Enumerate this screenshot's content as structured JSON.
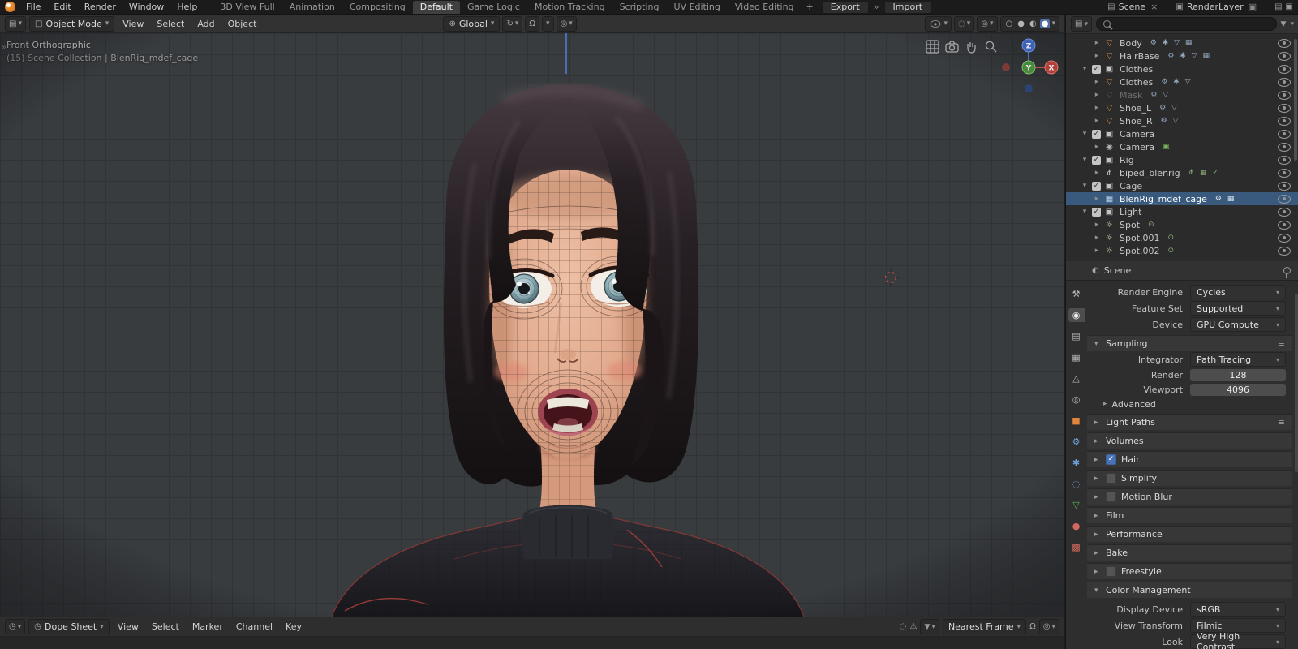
{
  "icons": {
    "disclosure_collapsed": "▸",
    "disclosure_expanded": "▾",
    "dropdown_arrow": "▾",
    "mesh": "▽",
    "collection": "▣",
    "camera": "◉",
    "armature": "⋔",
    "lattice": "▦",
    "light": "☼",
    "check": "✓",
    "menu": "≡",
    "orientation_globe": "⊕",
    "pivot": "↻",
    "magnet": "Ω",
    "proportional": "◎",
    "close": "×",
    "chevrons": "»",
    "mode_cube": "□",
    "editor_grid": "▤",
    "scene_strip": "▤",
    "layers": "▣",
    "warning": "⚠",
    "funnel": "▼",
    "ghost": "◌",
    "clock": "◷",
    "ball": "●",
    "ball_open": "○",
    "ball_half": "◐"
  },
  "topbar": {
    "app_menus": [
      "File",
      "Edit",
      "Render",
      "Window",
      "Help"
    ],
    "workspaces": [
      "3D View Full",
      "Animation",
      "Compositing",
      "Default",
      "Game Logic",
      "Motion Tracking",
      "Scripting",
      "UV Editing",
      "Video Editing"
    ],
    "active_workspace": "Default",
    "new_workspace_button": "+",
    "export_button": "Export",
    "import_button": "Import",
    "scene_name": "Scene",
    "render_layer_name": "RenderLayer"
  },
  "viewport_header": {
    "mode": "Object Mode",
    "menus": [
      "View",
      "Select",
      "Add",
      "Object"
    ],
    "orientation": "Global"
  },
  "viewport_overlay": {
    "view_name": "Front Orthographic",
    "active_collection": "(15) Scene Collection | BlenRig_mdef_cage"
  },
  "gizmo": {
    "x_label": "X",
    "y_label": "Y",
    "z_label": "Z"
  },
  "outliner": {
    "items": [
      {
        "label": "Body",
        "badges": "⚙ ✱ ▽ ▦"
      },
      {
        "label": "HairBase",
        "badges": "⚙ ✱ ▽ ▦"
      },
      {
        "label": "Clothes",
        "badges": ""
      },
      {
        "label": "Clothes",
        "badges": "⚙ ✱ ▽"
      },
      {
        "label": "Mask",
        "badges": "⚙ ▽"
      },
      {
        "label": "Shoe_L",
        "badges": "⚙ ▽"
      },
      {
        "label": "Shoe_R",
        "badges": "⚙ ▽"
      },
      {
        "label": "Camera",
        "badges": ""
      },
      {
        "label": "Camera",
        "badges": "▣"
      },
      {
        "label": "Rig",
        "badges": ""
      },
      {
        "label": "biped_blenrig",
        "badges": "⋔ ▦ ✓"
      },
      {
        "label": "Cage",
        "badges": ""
      },
      {
        "label": "BlenRig_mdef_cage",
        "badges": "⚙ ▦"
      },
      {
        "label": "Light",
        "badges": ""
      },
      {
        "label": "Spot",
        "badges": "⊙"
      },
      {
        "label": "Spot.001",
        "badges": "⊙"
      },
      {
        "label": "Spot.002",
        "badges": "⊙"
      }
    ]
  },
  "properties": {
    "breadcrumb": "Scene",
    "render_engine_label": "Render Engine",
    "render_engine": "Cycles",
    "feature_set_label": "Feature Set",
    "feature_set": "Supported",
    "device_label": "Device",
    "device": "GPU Compute",
    "sampling_section": "Sampling",
    "integrator_label": "Integrator",
    "integrator": "Path Tracing",
    "render_label": "Render",
    "render_samples": "128",
    "viewport_label": "Viewport",
    "viewport_samples": "4096",
    "advanced_section": "Advanced",
    "light_paths_section": "Light Paths",
    "volumes_section": "Volumes",
    "hair_section": "Hair",
    "simplify_section": "Simplify",
    "motion_blur_section": "Motion Blur",
    "film_section": "Film",
    "performance_section": "Performance",
    "bake_section": "Bake",
    "freestyle_section": "Freestyle",
    "color_management_section": "Color Management",
    "display_device_label": "Display Device",
    "display_device": "sRGB",
    "view_transform_label": "View Transform",
    "view_transform": "Filmic",
    "look_label": "Look",
    "look": "Very High Contrast"
  },
  "dopesheet": {
    "editor_label": "Dope Sheet",
    "menus": [
      "View",
      "Select",
      "Marker",
      "Channel",
      "Key"
    ],
    "snap_mode": "Nearest Frame"
  }
}
